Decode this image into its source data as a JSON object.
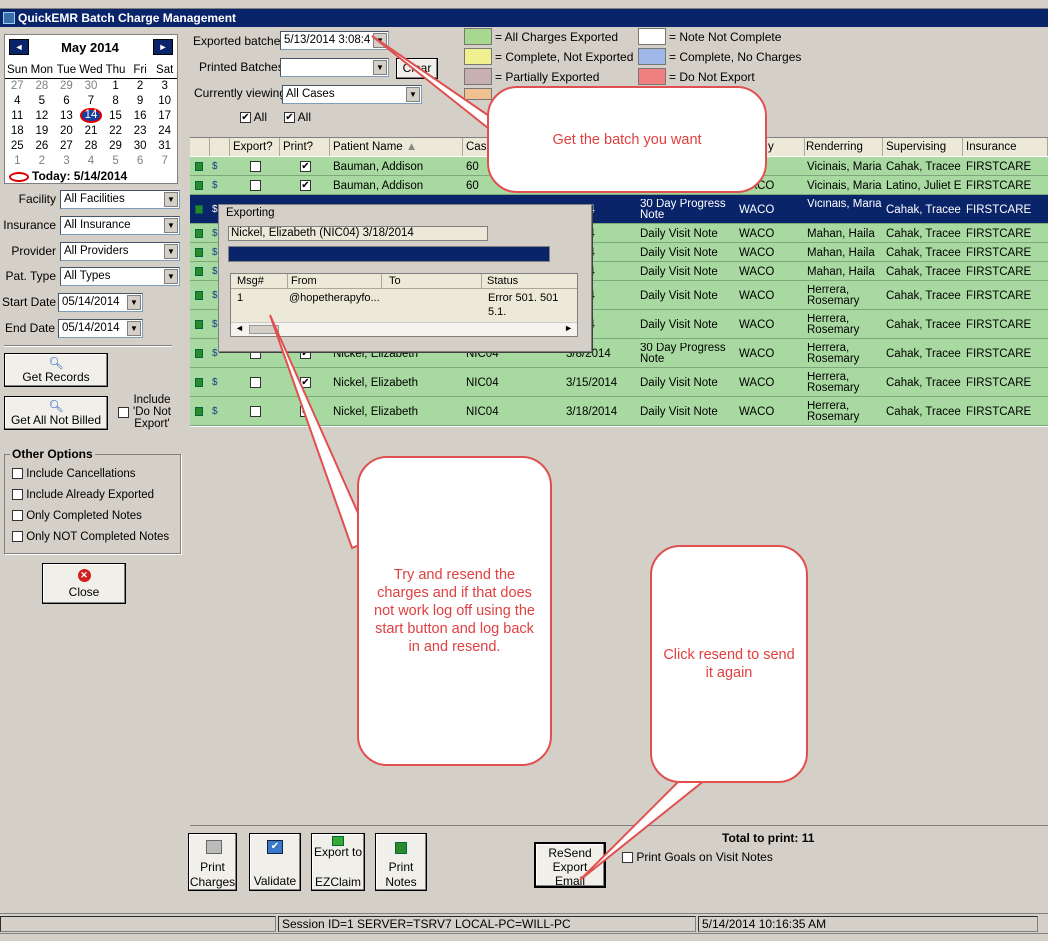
{
  "window": {
    "title": "QuickEMR Batch Charge Management"
  },
  "calendar": {
    "month_label": "May 2014",
    "prev_icon": "◄",
    "next_icon": "►",
    "weekdays": [
      "Sun",
      "Mon",
      "Tue",
      "Wed",
      "Thu",
      "Fri",
      "Sat"
    ],
    "weeks": [
      [
        "27",
        "28",
        "29",
        "30",
        "1",
        "2",
        "3"
      ],
      [
        "4",
        "5",
        "6",
        "7",
        "8",
        "9",
        "10"
      ],
      [
        "11",
        "12",
        "13",
        "14",
        "15",
        "16",
        "17"
      ],
      [
        "18",
        "19",
        "20",
        "21",
        "22",
        "23",
        "24"
      ],
      [
        "25",
        "26",
        "27",
        "28",
        "29",
        "30",
        "31"
      ],
      [
        "1",
        "2",
        "3",
        "4",
        "5",
        "6",
        "7"
      ]
    ],
    "today_label": "Today: 5/14/2014"
  },
  "filters": {
    "facility_label": "Facility",
    "facility_value": "All Facilities",
    "insurance_label": "Insurance",
    "insurance_value": "All Insurance",
    "provider_label": "Provider",
    "provider_value": "All Providers",
    "pattype_label": "Pat. Type",
    "pattype_value": "All Types",
    "start_label": "Start Date",
    "start_value": "05/14/2014",
    "end_label": "End Date",
    "end_value": "05/14/2014"
  },
  "buttons": {
    "get_records": "Get Records",
    "get_all_not_billed": "Get All Not Billed",
    "include_do_not_export_1": "Include",
    "include_do_not_export_2": "'Do Not",
    "include_do_not_export_3": "Export'",
    "close": "Close",
    "print_charges_1": "Print",
    "print_charges_2": "Charges",
    "validate": "Validate",
    "export_ezclaim_1": "Export to",
    "export_ezclaim_2": "EZClaim",
    "print_notes_1": "Print",
    "print_notes_2": "Notes",
    "resend_1": "ReSend",
    "resend_2": "Export",
    "resend_3": "Email",
    "clear": "Clear"
  },
  "other_options": {
    "title": "Other Options",
    "items": [
      "Include Cancellations",
      "Include Already Exported",
      "Only Completed Notes",
      "Only NOT Completed Notes"
    ]
  },
  "top": {
    "exported_batches_label": "Exported batches",
    "exported_batches_value": "5/13/2014 3:08:4",
    "printed_batches_label": "Printed Batches",
    "printed_batches_value": "",
    "currently_viewing_label": "Currently viewing:",
    "currently_viewing_value": "All Cases",
    "all1": "All",
    "all2": "All"
  },
  "legend": [
    {
      "label": "= All Charges Exported",
      "color": "#a8d890"
    },
    {
      "label": "= Complete, Not Exported",
      "color": "#f0f090"
    },
    {
      "label": "= Partially Exported",
      "color": "#c8b0b0"
    },
    {
      "label": "= Note Not Complete",
      "color": "#ffffff"
    },
    {
      "label": "= Complete, No Charges",
      "color": "#a0b8e8"
    },
    {
      "label": "= Do Not Export",
      "color": "#f08080"
    }
  ],
  "grid": {
    "headers": [
      "Export?",
      "Print?",
      "Patient Name",
      "Cas",
      "y",
      "Renderring",
      "Supervising",
      "Insurance"
    ],
    "rows": [
      {
        "name": "Bauman, Addison",
        "case": "60",
        "date": "",
        "type": "",
        "facility": "",
        "rendering": "Vicinais, Maria",
        "supervising": "Cahak, Tracee",
        "insurance": "FIRSTCARE"
      },
      {
        "name": "Bauman, Addison",
        "case": "60",
        "date": "",
        "type": "",
        "facility": "WACO",
        "rendering": "Vicinais, Maria",
        "supervising": "Latino, Juliet E",
        "insurance": "FIRSTCARE"
      },
      {
        "name": "",
        "case": "",
        "date": "/2014",
        "type": "30 Day Progress Note",
        "facility": "WACO",
        "rendering": "Vicinais, Maria",
        "supervising": "Cahak, Tracee",
        "insurance": "FIRSTCARE"
      },
      {
        "name": "",
        "case": "",
        "date": "/2014",
        "type": "Daily Visit Note",
        "facility": "WACO",
        "rendering": "Mahan, Haila",
        "supervising": "Cahak, Tracee",
        "insurance": "FIRSTCARE"
      },
      {
        "name": "",
        "case": "",
        "date": "/2014",
        "type": "Daily Visit Note",
        "facility": "WACO",
        "rendering": "Mahan, Haila",
        "supervising": "Cahak, Tracee",
        "insurance": "FIRSTCARE"
      },
      {
        "name": "",
        "case": "",
        "date": "/2014",
        "type": "Daily Visit Note",
        "facility": "WACO",
        "rendering": "Mahan, Haila",
        "supervising": "Cahak, Tracee",
        "insurance": "FIRSTCARE"
      },
      {
        "name": "",
        "case": "",
        "date": "/2014",
        "type": "Daily Visit Note",
        "facility": "WACO",
        "rendering": "Herrera, Rosemary",
        "supervising": "Cahak, Tracee",
        "insurance": "FIRSTCARE"
      },
      {
        "name": "",
        "case": "",
        "date": "/2014",
        "type": "Daily Visit Note",
        "facility": "WACO",
        "rendering": "Herrera, Rosemary",
        "supervising": "Cahak, Tracee",
        "insurance": "FIRSTCARE"
      },
      {
        "name": "Nickel, Elizabeth",
        "case": "NIC04",
        "date": "3/8/2014",
        "type": "30 Day Progress Note",
        "facility": "WACO",
        "rendering": "Herrera, Rosemary",
        "supervising": "Cahak, Tracee",
        "insurance": "FIRSTCARE"
      },
      {
        "name": "Nickel, Elizabeth",
        "case": "NIC04",
        "date": "3/15/2014",
        "type": "Daily Visit Note",
        "facility": "WACO",
        "rendering": "Herrera, Rosemary",
        "supervising": "Cahak, Tracee",
        "insurance": "FIRSTCARE"
      },
      {
        "name": "Nickel, Elizabeth",
        "case": "NIC04",
        "date": "3/18/2014",
        "type": "Daily Visit Note",
        "facility": "WACO",
        "rendering": "Herrera, Rosemary",
        "supervising": "Cahak, Tracee",
        "insurance": "FIRSTCARE"
      }
    ]
  },
  "dialog": {
    "title": "Exporting",
    "current_item": "Nickel, Elizabeth  (NIC04) 3/18/2014",
    "headers": [
      "Msg#",
      "From",
      "To",
      "Status"
    ],
    "row": {
      "msg": "1",
      "from": "@hopetherapyfo...",
      "to": "",
      "status": "Error 501. 501 5.1."
    }
  },
  "callouts": {
    "batch": "Get the batch you want",
    "resend_tip": "Try and resend the charges and if that does not work log off using the start button and log back in and resend.",
    "click_resend": "Click resend to send it again"
  },
  "footer": {
    "total_to_print": "Total to print: 11",
    "print_goals": "Print Goals on Visit Notes"
  },
  "statusbar": {
    "session": "Session ID=1 SERVER=TSRV7 LOCAL-PC=WILL-PC",
    "datetime": "5/14/2014 10:16:35 AM"
  }
}
